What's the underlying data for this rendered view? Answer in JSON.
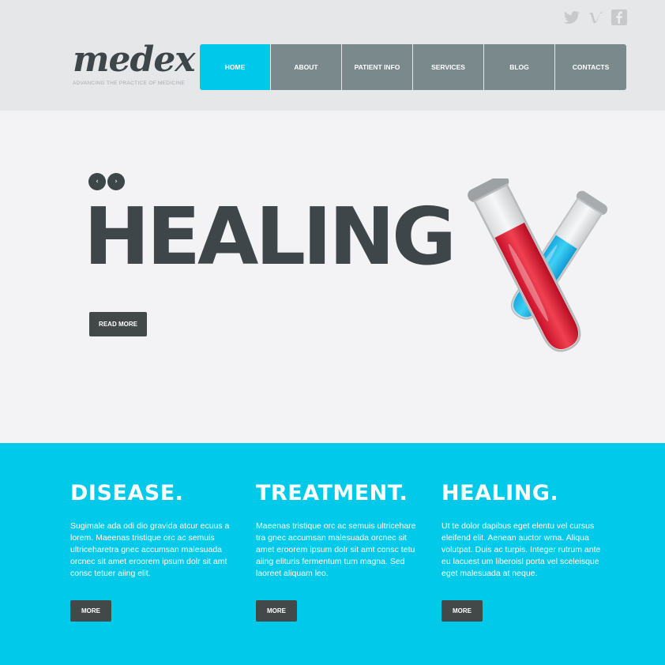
{
  "header": {
    "logo": {
      "name": "medex",
      "tagline": "ADVANCING THE PRACTICE OF MEDICINE"
    },
    "social_icons": [
      "twitter-icon",
      "vimeo-icon",
      "facebook-icon"
    ],
    "nav": [
      {
        "label": "HOME",
        "active": true
      },
      {
        "label": "ABOUT",
        "active": false
      },
      {
        "label": "PATIENT INFO",
        "active": false
      },
      {
        "label": "SERVICES",
        "active": false
      },
      {
        "label": "BLOG",
        "active": false
      },
      {
        "label": "CONTACTS",
        "active": false
      }
    ]
  },
  "hero": {
    "prev_arrow": "‹",
    "next_arrow": "›",
    "title": "HEALING",
    "button": "READ MORE",
    "image": "test-tubes-illustration"
  },
  "features": [
    {
      "title": "DISEASE.",
      "text": "Sugimale ada odi dio gravida atcur ecuus a lorem. Maeenas tristique orc ac semuis ultriceharetra gnec accumsan malesuada orcnec sit amet eroorem ipsum dolr sit amt consc tetuer aiing elit.",
      "button": "MORE"
    },
    {
      "title": "TREATMENT.",
      "text": "Maeenas tristique orc ac semuis ultricehare tra gnec accumsan malesuada orcnec sit amet eroorem ipsum dolr sit amt consc tetu aiing elituris fermentum tum magna. Sed laoreet aliquam leo.",
      "button": "MORE"
    },
    {
      "title": "HEALING.",
      "text": "Ut te dolor dapibus eget elentu vel cursus eleifend elit. Aenean auctor wrna. Aliqua volutpat. Duis ac turpis. Integer rutrum ante eu lacuest um liberoisl porta vel sceleisque eget malesuada at neque.",
      "button": "MORE"
    }
  ],
  "colors": {
    "accent": "#00c9ea",
    "nav": "#7a8a8c",
    "dark": "#3e4649",
    "button": "#434849"
  }
}
